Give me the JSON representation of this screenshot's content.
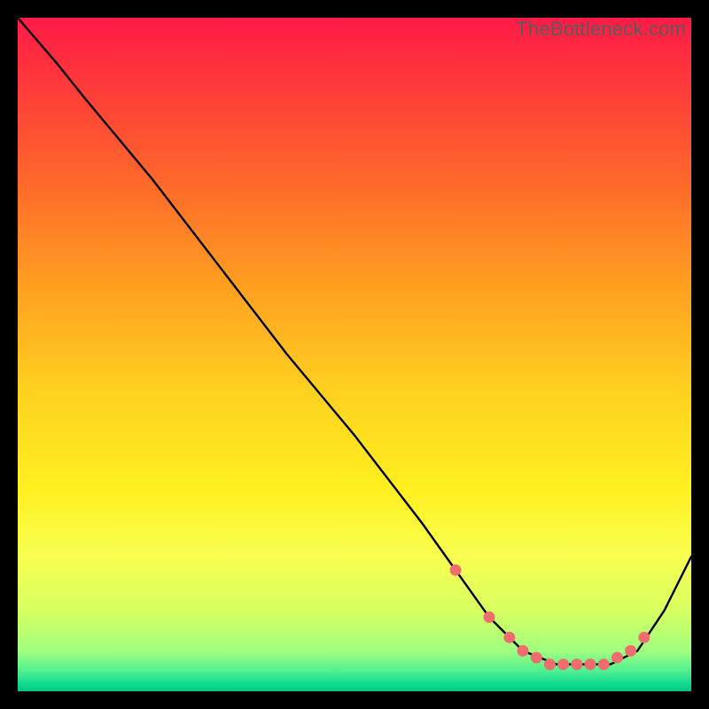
{
  "watermark": "TheBottleneck.com",
  "colors": {
    "curve_stroke": "#000000",
    "marker_fill": "#ee6e6e",
    "marker_stroke": "#ee6e6e"
  },
  "chart_data": {
    "type": "line",
    "title": "",
    "xlabel": "",
    "ylabel": "",
    "xlim": [
      0,
      100
    ],
    "ylim": [
      0,
      100
    ],
    "series": [
      {
        "name": "curve",
        "x": [
          0,
          6,
          10,
          20,
          30,
          40,
          50,
          60,
          65,
          70,
          75,
          80,
          85,
          88,
          92,
          96,
          100
        ],
        "y": [
          100,
          93,
          88,
          76,
          63,
          50,
          38,
          25,
          18,
          11,
          6,
          4,
          4,
          4,
          6,
          12,
          20
        ]
      }
    ],
    "markers": {
      "name": "highlight-points",
      "x": [
        65,
        70,
        73,
        75,
        77,
        79,
        81,
        83,
        85,
        87,
        89,
        91,
        93
      ],
      "y": [
        18,
        11,
        8,
        6,
        5,
        4,
        4,
        4,
        4,
        4,
        5,
        6,
        8
      ]
    }
  }
}
